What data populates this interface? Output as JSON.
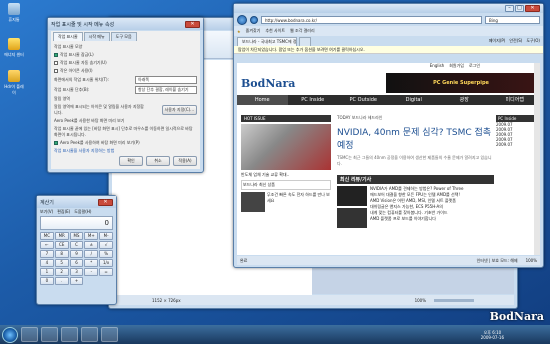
{
  "desktop": {
    "icons": [
      {
        "label": "휴지통",
        "icon": "recycle-bin-icon"
      },
      {
        "label": "에너지 센터",
        "icon": "energy-center-icon"
      },
      {
        "label": "Hdr이 플레이",
        "icon": "folder-icon"
      }
    ]
  },
  "dialog": {
    "title": "작업 표시줄 및 시작 메뉴 속성",
    "tabs": [
      "작업 표시줄",
      "시작 메뉴",
      "도구 모음"
    ],
    "section1": "작업 표시줄 모양",
    "options": [
      {
        "label": "작업 표시줄 잠금(L)",
        "checked": true
      },
      {
        "label": "작업 표시줄 자동 숨기기(U)",
        "checked": false
      },
      {
        "label": "작은 아이콘 사용(I)",
        "checked": false
      }
    ],
    "position_label": "화면에서의 작업 표시줄 위치(T):",
    "position_value": "아래쪽",
    "buttons_label": "작업 표시줄 단추(B):",
    "buttons_value": "항상 단추 결합, 레이블 숨기기",
    "notify_section": "알림 영역",
    "notify_text": "알림 영역에 표시되는 아이콘 및 알림을 사용자 지정합니다.",
    "customize_btn": "사용자 지정(C)...",
    "aero_section": "Aero Peek를 사용한 바탕 화면 미리 보기",
    "aero_text": "작업 표시줄 끝에 있는 [바탕 화면 표시] 단추로 마우스를 이동하면 일시적으로 바탕 화면이 표시됩니다.",
    "aero_check": "Aero Peek를 사용하여 바탕 화면 미리 보기(P)",
    "help_link": "작업 표시줄을 사용자 지정하는 방법",
    "ok": "확인",
    "cancel": "취소",
    "apply": "적용(A)"
  },
  "paint": {
    "status": "1152 × 726px",
    "zoom": "100%"
  },
  "calculator": {
    "title": "계산기",
    "menu": [
      "보기(V)",
      "편집(E)",
      "도움말(H)"
    ],
    "display": "0",
    "keys": [
      "MC",
      "MR",
      "MS",
      "M+",
      "M-",
      "←",
      "CE",
      "C",
      "±",
      "√",
      "7",
      "8",
      "9",
      "/",
      "%",
      "4",
      "5",
      "6",
      "*",
      "1/x",
      "1",
      "2",
      "3",
      "-",
      "=",
      "0",
      ".",
      "+"
    ]
  },
  "ie": {
    "address": "http://www.bodnara.co.kr/",
    "search_placeholder": "Bing",
    "favorites_label": "즐겨찾기",
    "fav_items": [
      "추천 사이트",
      "웹 조각 갤러리"
    ],
    "tabs": [
      "보드나라 - 국내최고 TSMC에 정 거대...",
      "(빈 탭)"
    ],
    "page_tools": [
      "페이지(P)",
      "안전(S)",
      "도구(O)"
    ],
    "notice": "팝업이 차단되었습니다. 팝업 또는 추가 옵션을 보려면 여기를 클릭하십시오.",
    "site": {
      "logo": "BodNara",
      "top_links": [
        "English",
        "회원가입",
        "로그인"
      ],
      "ad_text": "PC Genie  Superpipe",
      "nav": [
        "Home",
        "PC Inside",
        "PC Outside",
        "Digital",
        "광장",
        "미디어랩"
      ],
      "hot_issue": "HOT ISSUE",
      "today_label": "TODAY 보드나라 헤드라인",
      "headline": "NVIDIA, 40nm 문제 심각? TSMC 접촉예정",
      "headline_desc": "TSMC는 최근 그들의 40nm 공정을 이용하여 생산한 제품들의 수율 문제가 알려지고 있습니다.",
      "caption": "반도체 업체 기술 교류 확대..",
      "caption2": "신제품 플라즈마 파워 어셈블리",
      "latest_title": "최신 리뷰/기사",
      "reviews": [
        "NVIDIA가 AMD를 견제하는 방법은? Power of Three",
        "애드보어 대결을 향한 모든 FPU는 인텔 AMD를 선택!",
        "AMD Vision은 어떤 AMD, MSI, 인텔 서트 플랫폼",
        "대쉬링글은 앤지스 가능한, ECS P55H-A의",
        "내게 맞는 컴퓨터를 찾아봅니다. 기초반 가이드",
        "AMD 플랫폼 프로 보드를 이야기합니다"
      ],
      "side_label": "보드나라 최신 상품",
      "side_item": "무조건 빠른 속도 전자 하드를 만나 보세요",
      "pc_inside": "PC Inside",
      "right_list": [
        "2009.07",
        "2009.07",
        "2009.07",
        "2009.07",
        "2009.07"
      ]
    },
    "status_left": "완료",
    "status_mid": "인터넷 | 보호 모드: 해제",
    "status_zoom": "100%"
  },
  "taskbar": {
    "items": [
      "start-orb",
      "ie",
      "explorer",
      "media-player",
      "paint",
      "calculator"
    ],
    "time": "오후 6:10",
    "date": "2009-07-16"
  },
  "watermark": "BodNara",
  "colors": {
    "bodnara_red": "#cc2a1f",
    "nav_bg": "#2d2d2d",
    "headline": "#1d4f91"
  }
}
